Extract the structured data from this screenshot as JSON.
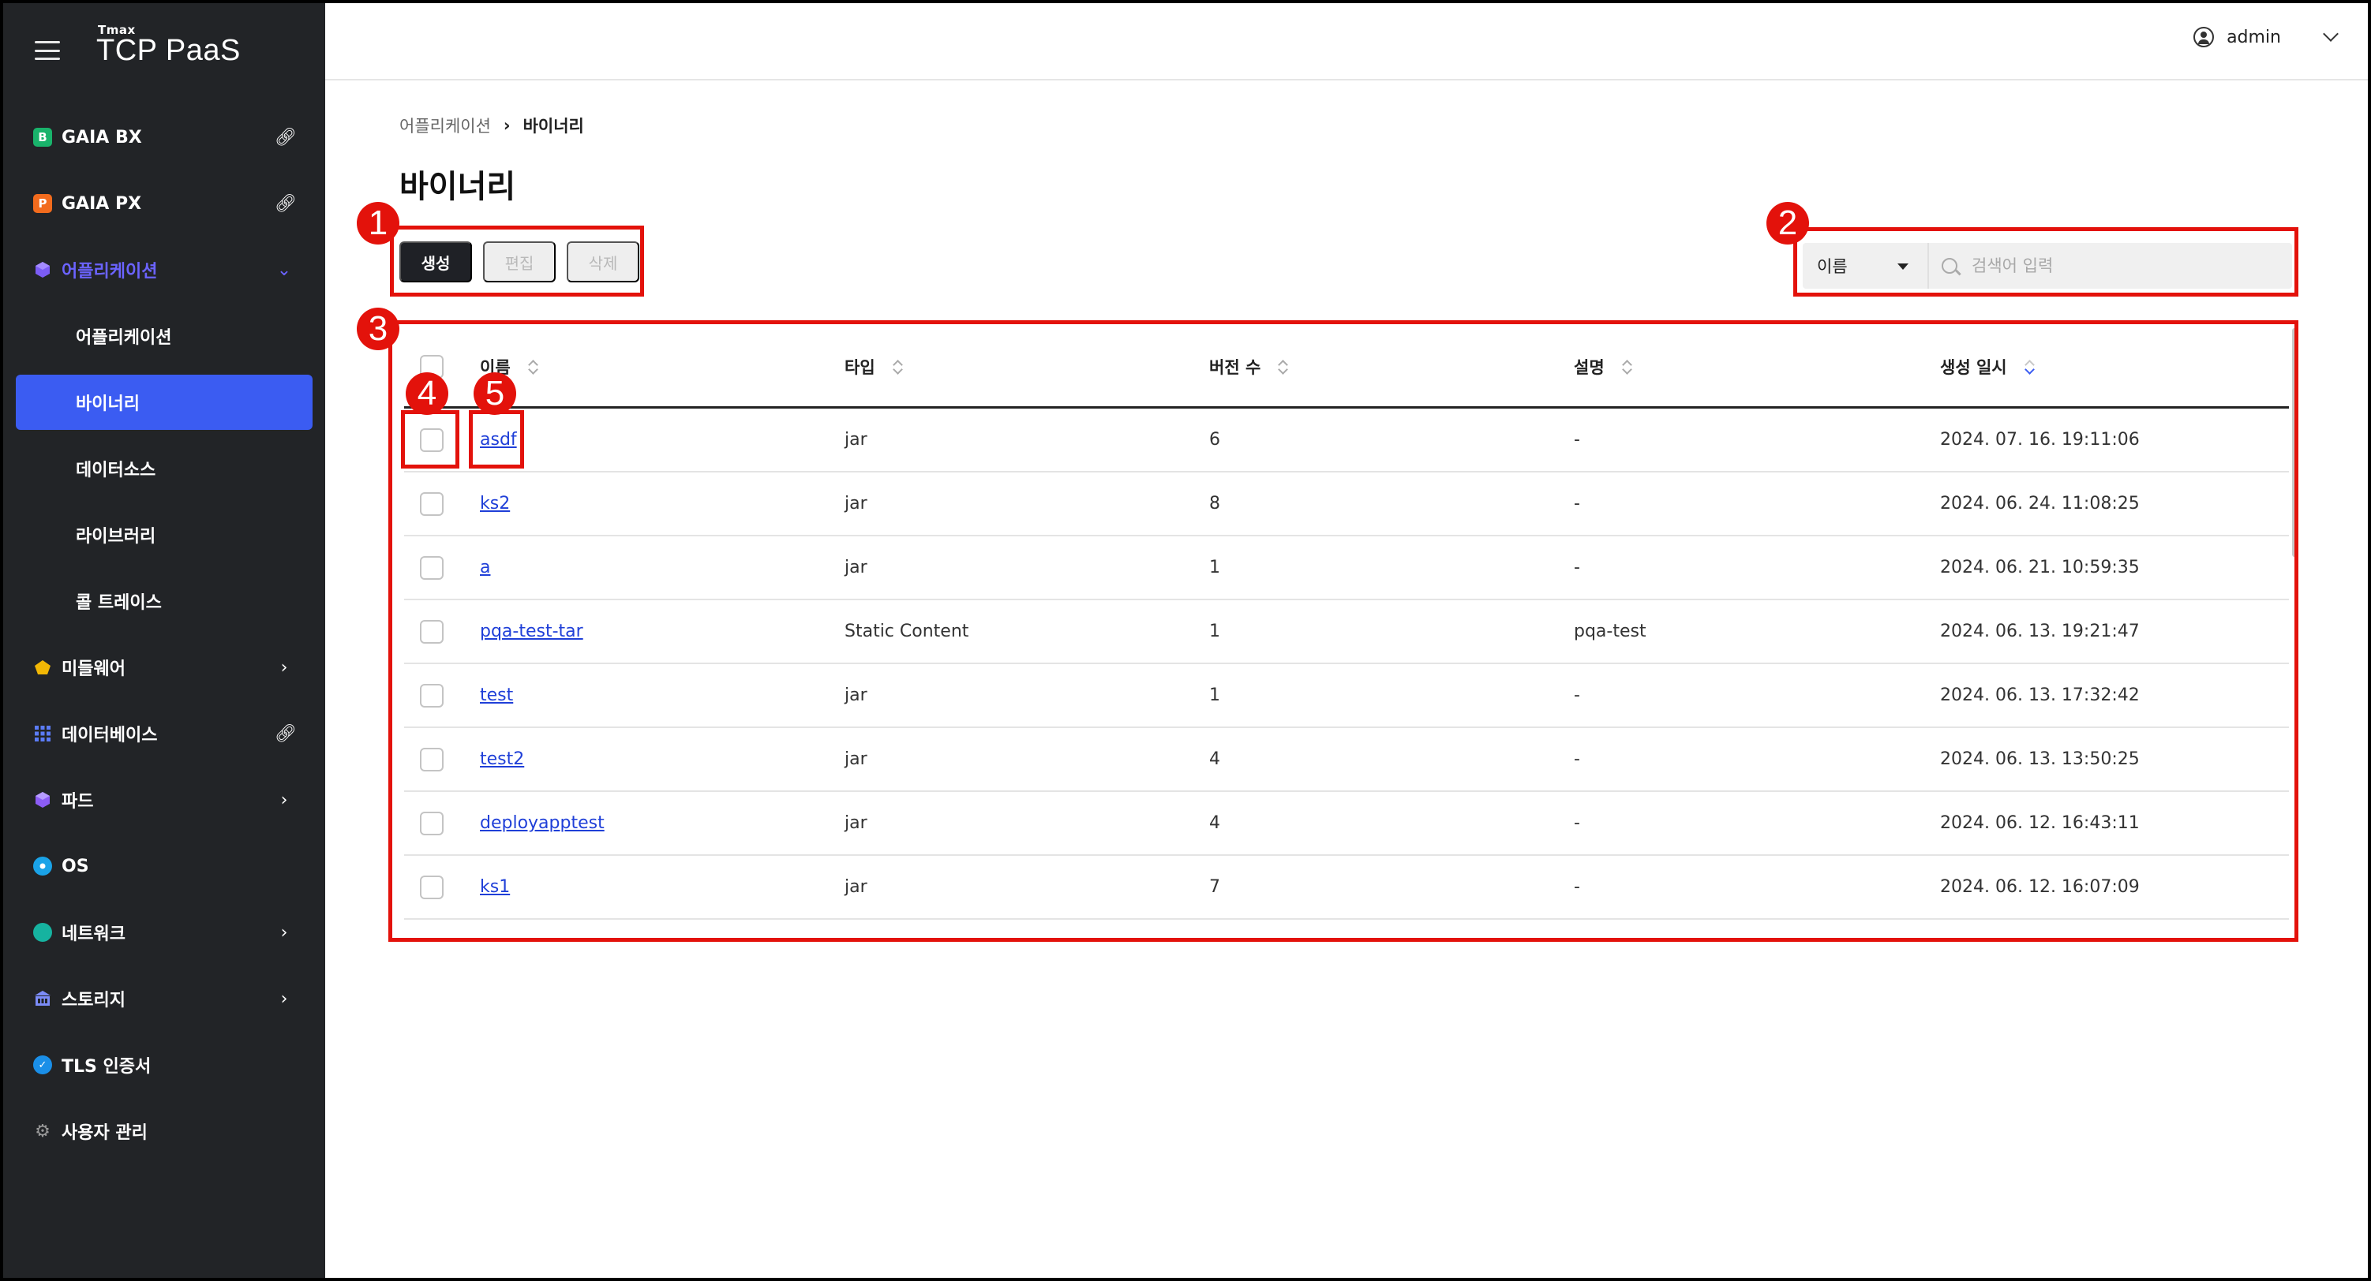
{
  "app": {
    "brand_small": "Tmax",
    "brand_name": "TCP PaaS"
  },
  "sidebar": {
    "items": [
      {
        "label": "GAIA BX",
        "icon": "gaia-bx-icon",
        "color": "#19b36b",
        "glyph": "B",
        "right": "link"
      },
      {
        "label": "GAIA PX",
        "icon": "gaia-px-icon",
        "color": "#f26b1d",
        "glyph": "P",
        "right": "link"
      },
      {
        "label": "어플리케이션",
        "icon": "application-cube-icon",
        "color": "#7b5cf5",
        "glyph": "",
        "right": "chevron-down"
      },
      {
        "label": "미들웨어",
        "icon": "middleware-icon",
        "color": "#f2b705",
        "glyph": "",
        "right": "chevron-right"
      },
      {
        "label": "데이터베이스",
        "icon": "database-grid-icon",
        "color": "#3b5cf2",
        "glyph": "",
        "right": "link"
      },
      {
        "label": "파드",
        "icon": "pod-cube-icon",
        "color": "#8c5cf5",
        "glyph": "",
        "right": "chevron-right"
      },
      {
        "label": "OS",
        "icon": "os-icon",
        "color": "#1aa3e8",
        "glyph": "",
        "right": ""
      },
      {
        "label": "네트워크",
        "icon": "network-globe-icon",
        "color": "#16b3a0",
        "glyph": "",
        "right": "chevron-right"
      },
      {
        "label": "스토리지",
        "icon": "storage-building-icon",
        "color": "#7c8cf8",
        "glyph": "",
        "right": "chevron-right"
      },
      {
        "label": "TLS 인증서",
        "icon": "tls-certificate-icon",
        "color": "#1a8fe8",
        "glyph": "",
        "right": ""
      },
      {
        "label": "사용자 관리",
        "icon": "user-management-gear-icon",
        "color": "#9a9a9a",
        "glyph": "",
        "right": ""
      }
    ],
    "sub_items": [
      "어플리케이션",
      "바이너리",
      "데이터소스",
      "라이브러리",
      "콜 트레이스"
    ],
    "selected_sub": "바이너리"
  },
  "header": {
    "user_name": "admin"
  },
  "page": {
    "breadcrumb_parent": "어플리케이션",
    "breadcrumb_current": "바이너리",
    "title": "바이너리"
  },
  "actions": {
    "create": "생성",
    "edit": "편집",
    "delete": "삭제"
  },
  "search": {
    "field": "이름",
    "placeholder": "검색어 입력"
  },
  "table": {
    "columns": [
      "이름",
      "타입",
      "버전 수",
      "설명",
      "생성 일시"
    ],
    "rows": [
      {
        "name": "asdf",
        "type": "jar",
        "versions": "6",
        "desc": "-",
        "created": "2024. 07. 16. 19:11:06"
      },
      {
        "name": "ks2",
        "type": "jar",
        "versions": "8",
        "desc": "-",
        "created": "2024. 06. 24. 11:08:25"
      },
      {
        "name": "a",
        "type": "jar",
        "versions": "1",
        "desc": "-",
        "created": "2024. 06. 21. 10:59:35"
      },
      {
        "name": "pqa-test-tar",
        "type": "Static Content",
        "versions": "1",
        "desc": "pqa-test",
        "created": "2024. 06. 13. 19:21:47"
      },
      {
        "name": "test",
        "type": "jar",
        "versions": "1",
        "desc": "-",
        "created": "2024. 06. 13. 17:32:42"
      },
      {
        "name": "test2",
        "type": "jar",
        "versions": "4",
        "desc": "-",
        "created": "2024. 06. 13. 13:50:25"
      },
      {
        "name": "deployapptest",
        "type": "jar",
        "versions": "4",
        "desc": "-",
        "created": "2024. 06. 12. 16:43:11"
      },
      {
        "name": "ks1",
        "type": "jar",
        "versions": "7",
        "desc": "-",
        "created": "2024. 06. 12. 16:07:09"
      }
    ]
  },
  "annotations": [
    "1",
    "2",
    "3",
    "4",
    "5"
  ],
  "colors": {
    "sidebar_bg": "#222427",
    "accent": "#3b5cf2",
    "annotation_red": "#e3120b",
    "link": "#1f3fd8"
  }
}
